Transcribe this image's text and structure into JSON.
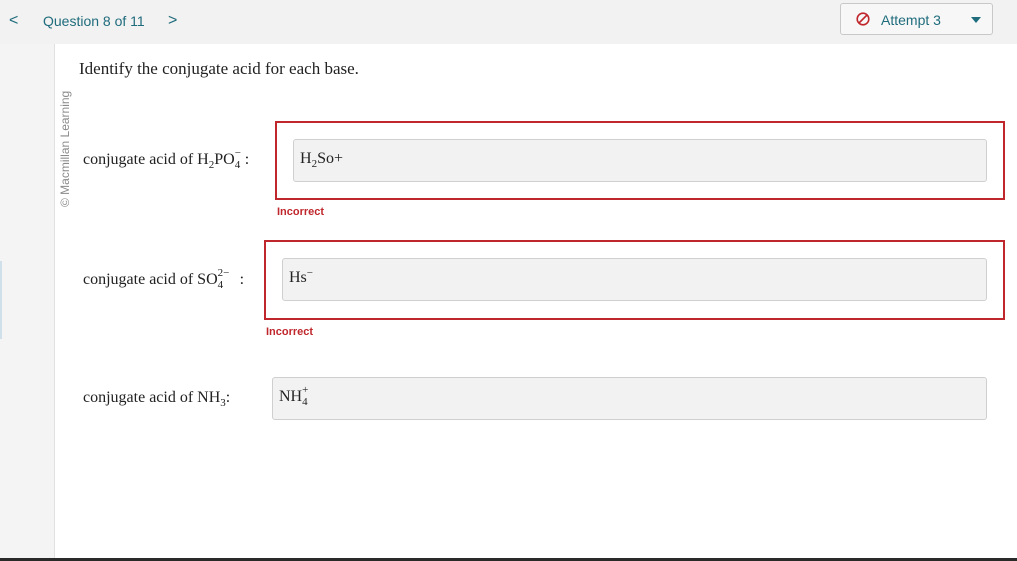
{
  "nav": {
    "prev": "<",
    "question_label": "Question 8 of 11",
    "next": ">"
  },
  "attempt": {
    "label": "Attempt 3",
    "icon": "prohibited-icon",
    "icon_color": "#c0272d"
  },
  "copyright": "© Macmillan Learning",
  "prompt": "Identify the conjugate acid for each base.",
  "questions": [
    {
      "label_prefix": "conjugate acid of H",
      "sub1": "2",
      "mid": "PO",
      "sup": "−",
      "sub2": "4",
      "suffix": ":",
      "answer_main": "H",
      "answer_sub": "2",
      "answer_rest": "So+",
      "status": "Incorrect"
    },
    {
      "label_prefix": "conjugate acid of SO",
      "sup": "2−",
      "sub": "4",
      "suffix": ":",
      "answer_main": "Hs",
      "answer_sup": "−",
      "status": "Incorrect"
    },
    {
      "label_prefix": "conjugate acid of NH",
      "sub": "3",
      "suffix": ":",
      "answer_main": "NH",
      "answer_sup": "+",
      "answer_sub": "4"
    }
  ],
  "colors": {
    "accent": "#1f6c7c",
    "error": "#c0272d"
  }
}
